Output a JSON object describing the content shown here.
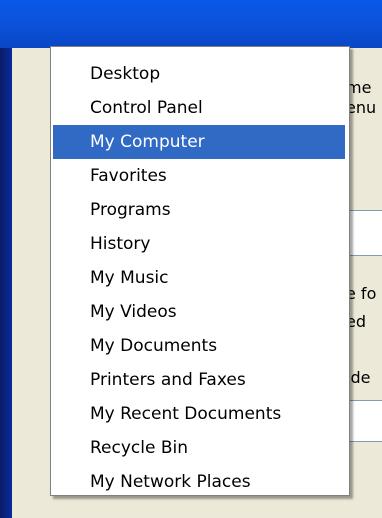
{
  "menu": {
    "items": [
      {
        "label": "Desktop",
        "selected": false
      },
      {
        "label": "Control Panel",
        "selected": false
      },
      {
        "label": "My Computer",
        "selected": true
      },
      {
        "label": "Favorites",
        "selected": false
      },
      {
        "label": "Programs",
        "selected": false
      },
      {
        "label": "History",
        "selected": false
      },
      {
        "label": "My Music",
        "selected": false
      },
      {
        "label": "My Videos",
        "selected": false
      },
      {
        "label": "My Documents",
        "selected": false
      },
      {
        "label": "Printers and Faxes",
        "selected": false
      },
      {
        "label": "My Recent Documents",
        "selected": false
      },
      {
        "label": "Recycle Bin",
        "selected": false
      },
      {
        "label": "My Network Places",
        "selected": false
      }
    ]
  },
  "background_text": {
    "line1": "me",
    "line2": "enu",
    "line3": "e fo",
    "line4": "ed",
    "line5": "lde"
  },
  "colors": {
    "selection": "#316ac5",
    "titlebar": "#0a58e8",
    "dialog": "#ece9d8"
  }
}
